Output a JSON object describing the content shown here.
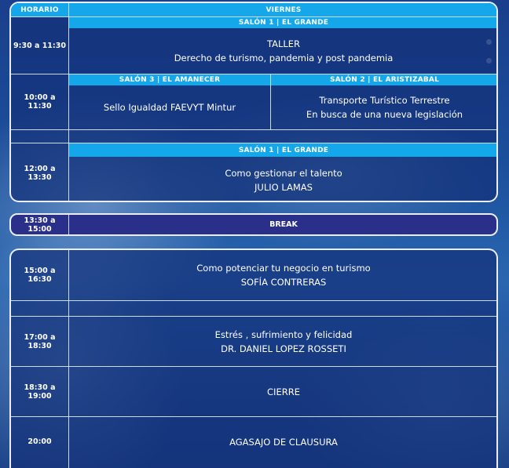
{
  "header": {
    "horario": "HORARIO",
    "day": "VIERNES"
  },
  "rooms": {
    "salon1": "SALÓN 1 | EL GRANDE",
    "salon3": "SALÓN 3 | EL AMANECER",
    "salon2": "SALÓN 2 | EL ARISTIZABAL"
  },
  "rows": [
    {
      "time": "9:30 a 11:30",
      "line1": "TALLER",
      "line2": "Derecho de turismo, pandemia y post pandemia"
    },
    {
      "time": "10:00 a 11:30",
      "left": "Sello Igualdad FAEVYT Mintur",
      "right1": "Transporte Turístico Terrestre",
      "right2": "En busca de una nueva legislación"
    },
    {
      "time": "12:00 a 13:30",
      "line1": "Como gestionar el talento",
      "line2": "JULIO LAMAS"
    }
  ],
  "break": {
    "time": "13:30 a 15:00",
    "label": "BREAK"
  },
  "afternoon": [
    {
      "time": "15:00 a 16:30",
      "line1": "Como potenciar tu negocio en turismo",
      "line2": "SOFÍA CONTRERAS"
    },
    {
      "time": "17:00 a 18:30",
      "line1": "Estrés , sufrimiento y felicidad",
      "line2": "DR. DANIEL LOPEZ ROSSETI"
    },
    {
      "time": "18:30 a 19:00",
      "line1": "CIERRE"
    },
    {
      "time": "20:00",
      "line1": "AGASAJO DE CLAUSURA"
    }
  ],
  "colors": {
    "header_cyan": "#14a8ea",
    "break_purple": "#2a2f8a",
    "panel_border": "#e9eef8"
  }
}
